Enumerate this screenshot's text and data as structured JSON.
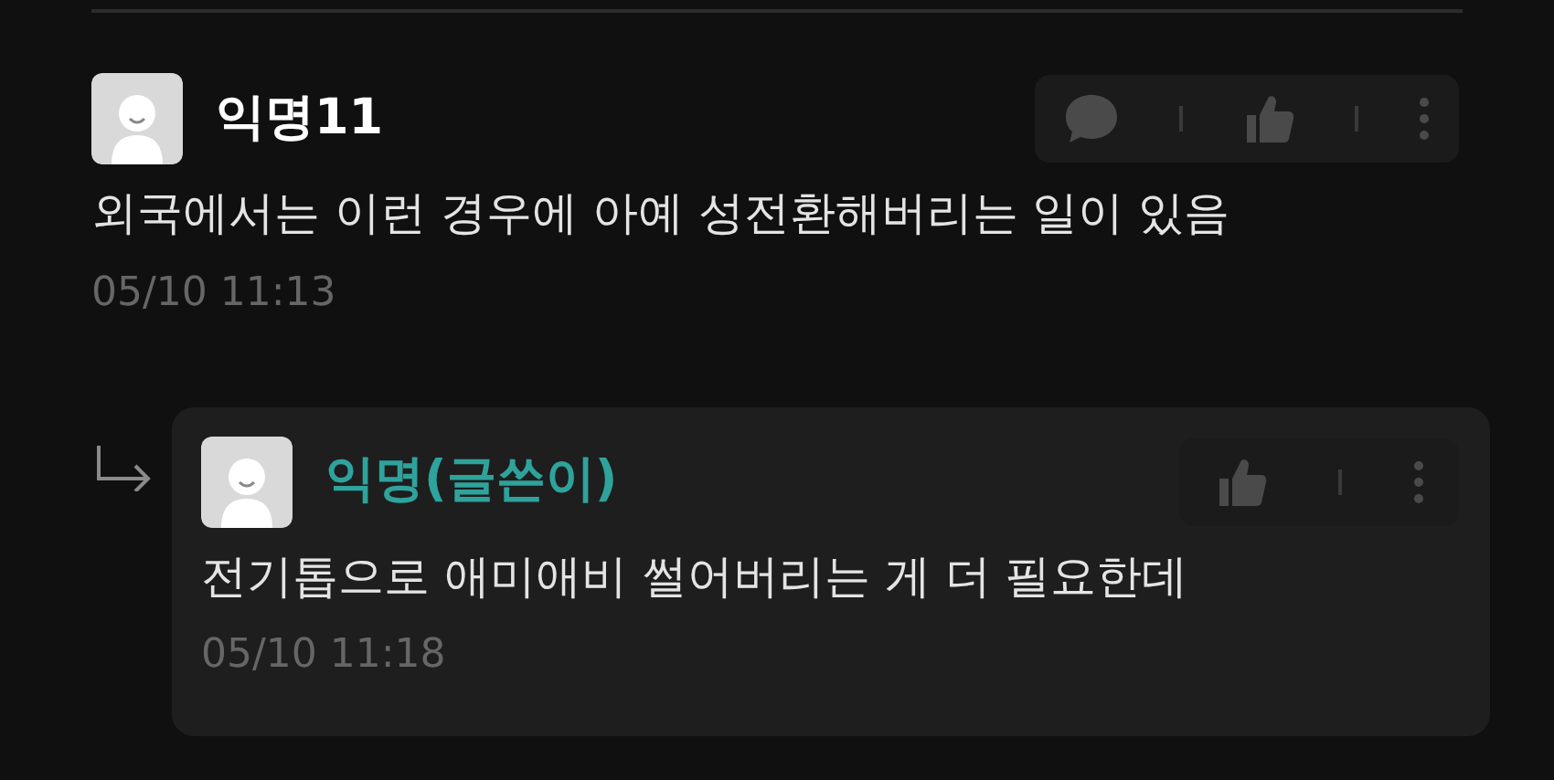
{
  "comments": [
    {
      "kind": "comment",
      "author": "익명11",
      "is_writer": false,
      "body": "외국에서는 이런 경우에 아예 성전환해버리는 일이 있음",
      "time": "05/10 11:13",
      "actions": [
        {
          "kind": "comment"
        },
        {
          "kind": "like"
        },
        {
          "kind": "more"
        }
      ]
    },
    {
      "kind": "reply",
      "author": "익명(글쓴이)",
      "is_writer": true,
      "body": "전기톱으로 애미애비 썰어버리는 게 더 필요한데",
      "time": "05/10 11:18",
      "actions": [
        {
          "kind": "like"
        },
        {
          "kind": "more"
        }
      ]
    }
  ]
}
